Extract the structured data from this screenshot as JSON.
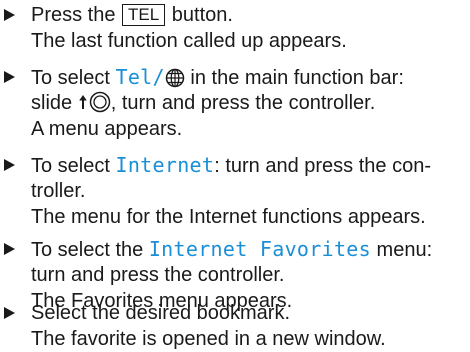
{
  "steps": [
    {
      "lines": [
        {
          "pre": "Press the ",
          "key": "TEL",
          "post": " button."
        },
        {
          "text": "The last function called up appears."
        }
      ]
    },
    {
      "lines": [
        {
          "pre": "To select ",
          "hl": "Tel/",
          "icon": "globe-icon",
          "post": " in the main function bar:"
        },
        {
          "pre": "slide ",
          "icon": "slide-up-controller-icon",
          "post": ", turn and press the controller."
        },
        {
          "text": "A menu appears."
        }
      ]
    },
    {
      "lines": [
        {
          "pre": "To select ",
          "hl": "Internet",
          "post": ": turn and press the con-"
        },
        {
          "text": "troller."
        },
        {
          "text": "The menu for the Internet functions appears."
        }
      ]
    },
    {
      "lines": [
        {
          "pre": "To select the ",
          "hl": "Internet Favorites",
          "post": " menu:"
        },
        {
          "text": "turn and press the controller."
        },
        {
          "text": "The Favorites menu appears."
        }
      ]
    },
    {
      "lines": [
        {
          "text": "Select the desired bookmark."
        },
        {
          "text": "The favorite is opened in a new window."
        }
      ]
    }
  ]
}
